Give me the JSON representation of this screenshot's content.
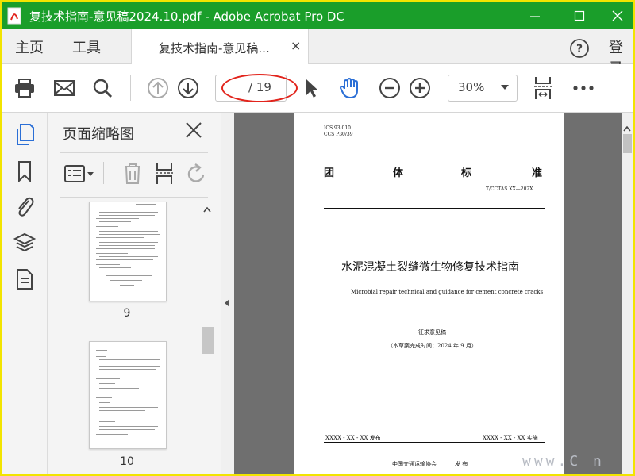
{
  "window": {
    "title": "复技术指南-意见稿2024.10.pdf - Adobe Acrobat Pro DC",
    "minimize_icon": "minimize-icon",
    "maximize_icon": "maximize-icon",
    "close_icon": "close-icon"
  },
  "menubar": {
    "home": "主页",
    "tools": "工具",
    "doc_tab": "复技术指南-意见稿...",
    "doc_tab_close": "×",
    "login": "登录"
  },
  "toolbar": {
    "page_total": "/ 19",
    "zoom": "30%"
  },
  "thumb_panel": {
    "title": "页面缩略图",
    "thumbnails": [
      {
        "page": "9"
      },
      {
        "page": "10"
      }
    ]
  },
  "document": {
    "ics": "ICS 93.010",
    "ccs": "CCS P30/39",
    "std_chars": [
      "团",
      "体",
      "标",
      "准"
    ],
    "std_code": "T/CCTAS XX—202X",
    "title_cn": "水泥混凝土裂缝微生物修复技术指南",
    "title_en": "Microbial repair technical and guidance for cement concrete cracks",
    "draft": "征求意见稿",
    "draft_date": "（本草案完成时间：2024 年 9 月）",
    "publish_date": "XXXX - XX - XX 发布",
    "implement_date": "XXXX - XX - XX 实施",
    "publisher": "中国交通运输协会",
    "publish_word": "发 布"
  },
  "watermark": "www.C      n",
  "colors": {
    "titlebar": "#1a9e2a",
    "accent_blue": "#2b6fd6",
    "highlight_red": "#e2241c"
  }
}
